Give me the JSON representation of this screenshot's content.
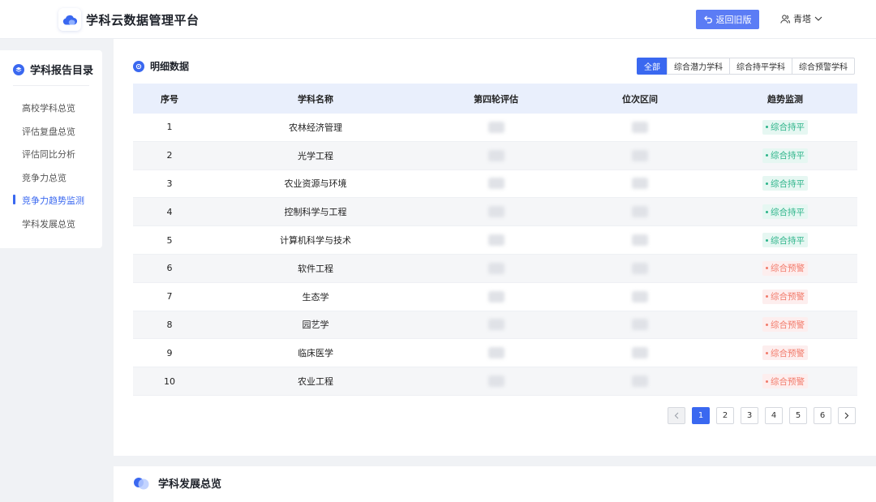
{
  "header": {
    "app_title": "学科云数据管理平台",
    "back_label": "返回旧版",
    "user_name": "青塔"
  },
  "sidebar": {
    "title": "学科报告目录",
    "items": [
      {
        "label": "高校学科总览",
        "active": false
      },
      {
        "label": "评估复盘总览",
        "active": false
      },
      {
        "label": "评估同比分析",
        "active": false
      },
      {
        "label": "竞争力总览",
        "active": false
      },
      {
        "label": "竞争力趋势监测",
        "active": true
      },
      {
        "label": "学科发展总览",
        "active": false
      }
    ]
  },
  "detail": {
    "title": "明细数据",
    "filters": [
      "全部",
      "综合潜力学科",
      "综合持平学科",
      "综合预警学科"
    ],
    "active_filter": "全部",
    "columns": [
      "序号",
      "学科名称",
      "第四轮评估",
      "位次区间",
      "趋势监测"
    ],
    "rows": [
      {
        "index": "1",
        "name": "农林经济管理",
        "trend": "综合持平",
        "status": "stable"
      },
      {
        "index": "2",
        "name": "光学工程",
        "trend": "综合持平",
        "status": "stable"
      },
      {
        "index": "3",
        "name": "农业资源与环境",
        "trend": "综合持平",
        "status": "stable"
      },
      {
        "index": "4",
        "name": "控制科学与工程",
        "trend": "综合持平",
        "status": "stable"
      },
      {
        "index": "5",
        "name": "计算机科学与技术",
        "trend": "综合持平",
        "status": "stable"
      },
      {
        "index": "6",
        "name": "软件工程",
        "trend": "综合预警",
        "status": "warn"
      },
      {
        "index": "7",
        "name": "生态学",
        "trend": "综合预警",
        "status": "warn"
      },
      {
        "index": "8",
        "name": "园艺学",
        "trend": "综合预警",
        "status": "warn"
      },
      {
        "index": "9",
        "name": "临床医学",
        "trend": "综合预警",
        "status": "warn"
      },
      {
        "index": "10",
        "name": "农业工程",
        "trend": "综合预警",
        "status": "warn"
      }
    ]
  },
  "pagination": {
    "pages": [
      "1",
      "2",
      "3",
      "4",
      "5",
      "6"
    ],
    "current": "1",
    "prev_icon": "chevron-left-icon",
    "next_icon": "chevron-right-icon"
  },
  "section2": {
    "title": "学科发展总览"
  },
  "colors": {
    "accent": "#3a68f0",
    "stable": "#2db48a",
    "warn": "#f27b6b"
  }
}
